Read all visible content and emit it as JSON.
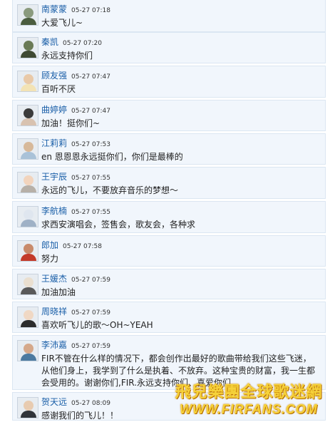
{
  "comments": [
    {
      "name": "南蒙蒙",
      "time": "05-27 07:18",
      "text": "大爱飞儿~",
      "avatar": "avatar-photo"
    },
    {
      "name": "秦凯",
      "time": "05-27 07:20",
      "text": "永远支持你们",
      "avatar": "avatar-photo"
    },
    {
      "name": "顾友强",
      "time": "05-27 07:47",
      "text": "百听不厌",
      "avatar": "avatar-photo"
    },
    {
      "name": "曲婷婷",
      "time": "05-27 07:47",
      "text": "加油！挺你们~",
      "avatar": "avatar-photo"
    },
    {
      "name": "江莉莉",
      "time": "05-27 07:53",
      "text": "en 恩恩恩永远挺你们，你们是最棒的",
      "avatar": "avatar-photo"
    },
    {
      "name": "王宇辰",
      "time": "05-27 07:55",
      "text": "永远的飞儿，不要放弃音乐的梦想～",
      "avatar": "avatar-photo"
    },
    {
      "name": "李航楠",
      "time": "05-27 07:55",
      "text": "求西安演唱会，签售会，歌友会，各种求",
      "avatar": "avatar-photo"
    },
    {
      "name": "郎加",
      "time": "05-27 07:58",
      "text": "努力",
      "avatar": "avatar-photo"
    },
    {
      "name": "王媛杰",
      "time": "05-27 07:59",
      "text": "加油加油",
      "avatar": "avatar-photo"
    },
    {
      "name": "周晓祥",
      "time": "05-27 07:59",
      "text": "喜欢听飞儿的歌～OH~YEAH",
      "avatar": "avatar-photo"
    },
    {
      "name": "李沛嘉",
      "time": "05-27 07:59",
      "text": "FIR不管在什么样的情况下，都会创作出最好的歌曲带给我们这些飞迷，从他们身上，我学到了什么是执着、不放弃。这种宝贵的财富，我一生都会受用的。谢谢你们,FIR.永远支持你们、喜爱你们",
      "avatar": "avatar-photo"
    },
    {
      "name": "贺天远",
      "time": "05-27 08:09",
      "text": "感谢我们的飞儿！！",
      "avatar": "avatar-photo"
    }
  ],
  "watermark": {
    "chinese": "飛兒樂團全球歌迷網",
    "url": "WWW.FIRFANS.COM",
    "color": "#f6d23a"
  },
  "colors": {
    "name": "#1a5fa8",
    "card_bg": "#f1f6fc",
    "card_border": "#dbe6f2"
  }
}
